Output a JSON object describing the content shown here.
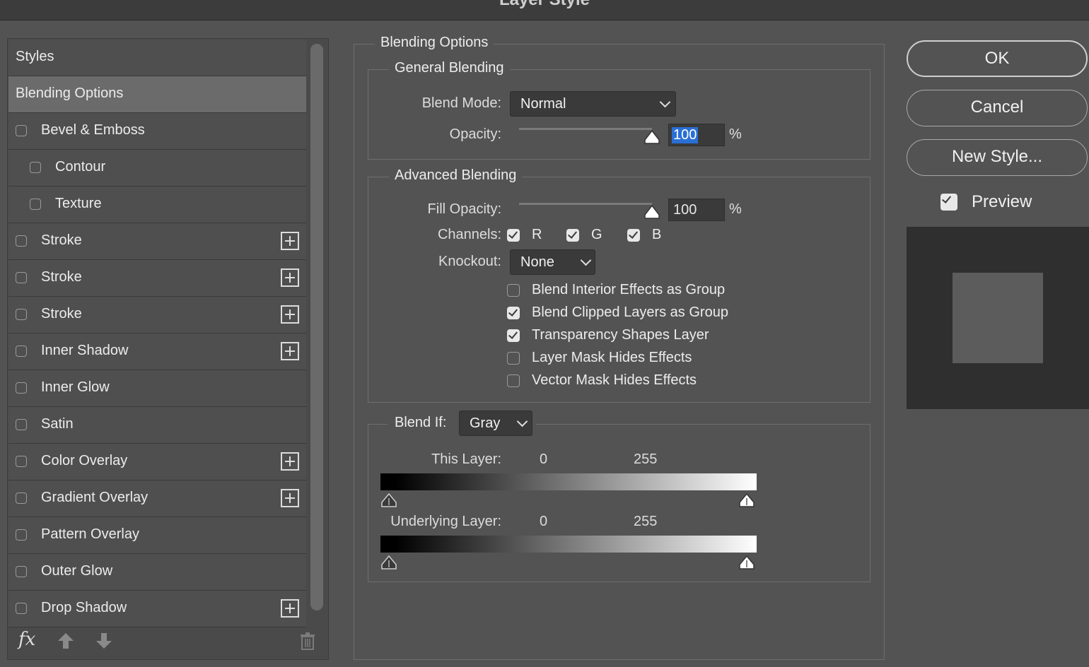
{
  "window": {
    "title": "Layer Style"
  },
  "style_list": {
    "header": "Styles",
    "items": [
      {
        "label": "Blending Options",
        "selected": true,
        "checkbox": false,
        "checked": false,
        "indent": false,
        "plus": false
      },
      {
        "label": "Bevel & Emboss",
        "checkbox": true,
        "checked": false,
        "indent": false,
        "plus": false
      },
      {
        "label": "Contour",
        "checkbox": true,
        "checked": false,
        "indent": true,
        "plus": false
      },
      {
        "label": "Texture",
        "checkbox": true,
        "checked": false,
        "indent": true,
        "plus": false
      },
      {
        "label": "Stroke",
        "checkbox": true,
        "checked": false,
        "indent": false,
        "plus": true
      },
      {
        "label": "Stroke",
        "checkbox": true,
        "checked": false,
        "indent": false,
        "plus": true
      },
      {
        "label": "Stroke",
        "checkbox": true,
        "checked": false,
        "indent": false,
        "plus": true
      },
      {
        "label": "Inner Shadow",
        "checkbox": true,
        "checked": false,
        "indent": false,
        "plus": true
      },
      {
        "label": "Inner Glow",
        "checkbox": true,
        "checked": false,
        "indent": false,
        "plus": false
      },
      {
        "label": "Satin",
        "checkbox": true,
        "checked": false,
        "indent": false,
        "plus": false
      },
      {
        "label": "Color Overlay",
        "checkbox": true,
        "checked": false,
        "indent": false,
        "plus": true
      },
      {
        "label": "Gradient Overlay",
        "checkbox": true,
        "checked": false,
        "indent": false,
        "plus": true
      },
      {
        "label": "Pattern Overlay",
        "checkbox": true,
        "checked": false,
        "indent": false,
        "plus": false
      },
      {
        "label": "Outer Glow",
        "checkbox": true,
        "checked": false,
        "indent": false,
        "plus": false
      },
      {
        "label": "Drop Shadow",
        "checkbox": true,
        "checked": false,
        "indent": false,
        "plus": true
      }
    ],
    "footer": {
      "fx_label": "fx",
      "icons": [
        "fx-icon",
        "move-up-icon",
        "move-down-icon",
        "trash-icon"
      ]
    }
  },
  "blending_options": {
    "title": "Blending Options",
    "general": {
      "title": "General Blending",
      "blend_mode_label": "Blend Mode:",
      "blend_mode": "Normal",
      "opacity_label": "Opacity:",
      "opacity": "100",
      "opacity_unit": "%",
      "opacity_fraction": 1.0
    },
    "advanced": {
      "title": "Advanced Blending",
      "fill_opacity_label": "Fill Opacity:",
      "fill_opacity": "100",
      "fill_opacity_unit": "%",
      "fill_opacity_fraction": 1.0,
      "channels_label": "Channels:",
      "channels": [
        {
          "label": "R",
          "checked": true
        },
        {
          "label": "G",
          "checked": true
        },
        {
          "label": "B",
          "checked": true
        }
      ],
      "knockout_label": "Knockout:",
      "knockout": "None",
      "options": [
        {
          "label": "Blend Interior Effects as Group",
          "checked": false
        },
        {
          "label": "Blend Clipped Layers as Group",
          "checked": true
        },
        {
          "label": "Transparency Shapes Layer",
          "checked": true
        },
        {
          "label": "Layer Mask Hides Effects",
          "checked": false
        },
        {
          "label": "Vector Mask Hides Effects",
          "checked": false
        }
      ]
    },
    "blend_if": {
      "label": "Blend If:",
      "channel": "Gray",
      "this_layer": {
        "label": "This Layer:",
        "low": "0",
        "high": "255"
      },
      "underlying_layer": {
        "label": "Underlying Layer:",
        "low": "0",
        "high": "255"
      }
    }
  },
  "actions": {
    "ok": "OK",
    "cancel": "Cancel",
    "new_style": "New Style...",
    "preview_label": "Preview",
    "preview_checked": true
  },
  "colors": {
    "background": "#535353",
    "selected_row": "#6b6b6b",
    "input_highlight": "#2a6fd6",
    "preview_bg": "#2f2f2f",
    "preview_swatch": "#5c5c5c"
  }
}
